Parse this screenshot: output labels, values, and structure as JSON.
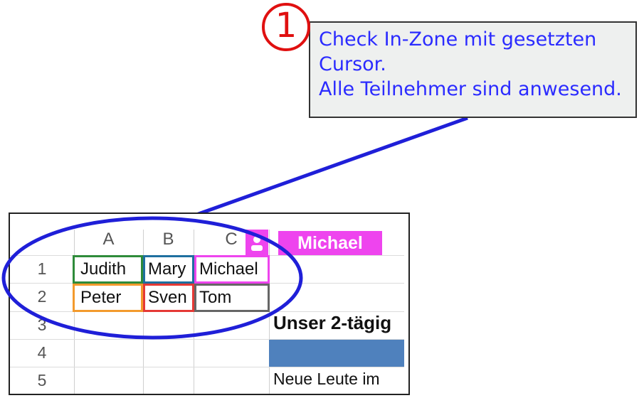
{
  "callout": {
    "number": "1",
    "lines": [
      "Check In-Zone mit gesetzten",
      "Cursor.",
      "Alle Teilnehmer sind anwesend."
    ]
  },
  "sheet": {
    "columns": [
      "A",
      "B",
      "C"
    ],
    "rows": [
      "1",
      "2",
      "3",
      "4",
      "5"
    ],
    "cells": {
      "A1": "Judith",
      "B1": "Mary",
      "C1": "Michael",
      "A2": "Peter",
      "B2": "Sven",
      "C2": "Tom",
      "D3": "Unser 2-tägig",
      "D5": "Neue Leute im"
    },
    "presence_label": "Michael"
  },
  "colors": {
    "callout_text": "#2b2bff",
    "ellipse": "#1f1fd8",
    "number_circle": "#e01010",
    "presence": "#ee44ee",
    "border_A1": "#2e8b3a",
    "border_B1": "#1e6f9f",
    "border_C1": "#ee44ee",
    "border_A2": "#f39a2d",
    "border_B2": "#e53935",
    "border_C2": "#666666",
    "blue_cell": "#4f81bd"
  }
}
